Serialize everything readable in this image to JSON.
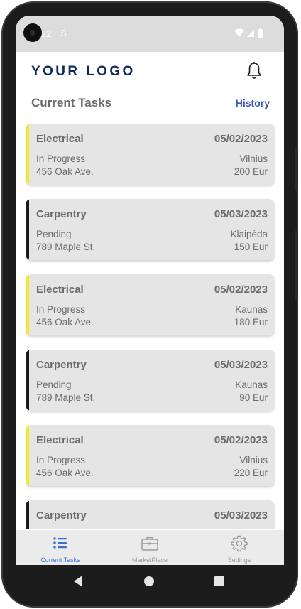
{
  "status_bar": {
    "time": "22",
    "indicator": "S",
    "icons": [
      "wifi-icon",
      "signal-icon",
      "battery-icon"
    ]
  },
  "header": {
    "logo": "YOUR LOGO",
    "notification_icon": "bell-icon"
  },
  "section": {
    "title": "Current Tasks",
    "history_link": "History"
  },
  "colors": {
    "accent_in_progress": "#f5e72f",
    "accent_pending": "#1a1a1a",
    "tab_active": "#3a6fd8",
    "tab_inactive": "#9a9a9a",
    "logo": "#0f2a5e",
    "link": "#3a55b8"
  },
  "tasks": [
    {
      "category": "Electrical",
      "date": "05/02/2023",
      "status": "In Progress",
      "address": "456 Oak Ave.",
      "city": "Vilnius",
      "price": "200 Eur"
    },
    {
      "category": "Carpentry",
      "date": "05/03/2023",
      "status": "Pending",
      "address": "789 Maple St.",
      "city": "Klaipėda",
      "price": "150 Eur"
    },
    {
      "category": "Electrical",
      "date": "05/02/2023",
      "status": "In Progress",
      "address": "456 Oak Ave.",
      "city": "Kaunas",
      "price": "180 Eur"
    },
    {
      "category": "Carpentry",
      "date": "05/03/2023",
      "status": "Pending",
      "address": "789 Maple St.",
      "city": "Kaunas",
      "price": "90 Eur"
    },
    {
      "category": "Electrical",
      "date": "05/02/2023",
      "status": "In Progress",
      "address": "456 Oak Ave.",
      "city": "Vilnius",
      "price": "220 Eur"
    },
    {
      "category": "Carpentry",
      "date": "05/03/2023",
      "status": "",
      "address": "",
      "city": "",
      "price": ""
    }
  ],
  "tab_bar": {
    "tabs": [
      {
        "label": "Current Tasks",
        "icon": "list-icon",
        "active": true
      },
      {
        "label": "MarketPlace",
        "icon": "briefcase-icon",
        "active": false
      },
      {
        "label": "Settings",
        "icon": "gear-icon",
        "active": false
      }
    ]
  },
  "nav_bar": {
    "buttons": [
      "back-icon",
      "home-icon",
      "recents-icon"
    ]
  }
}
